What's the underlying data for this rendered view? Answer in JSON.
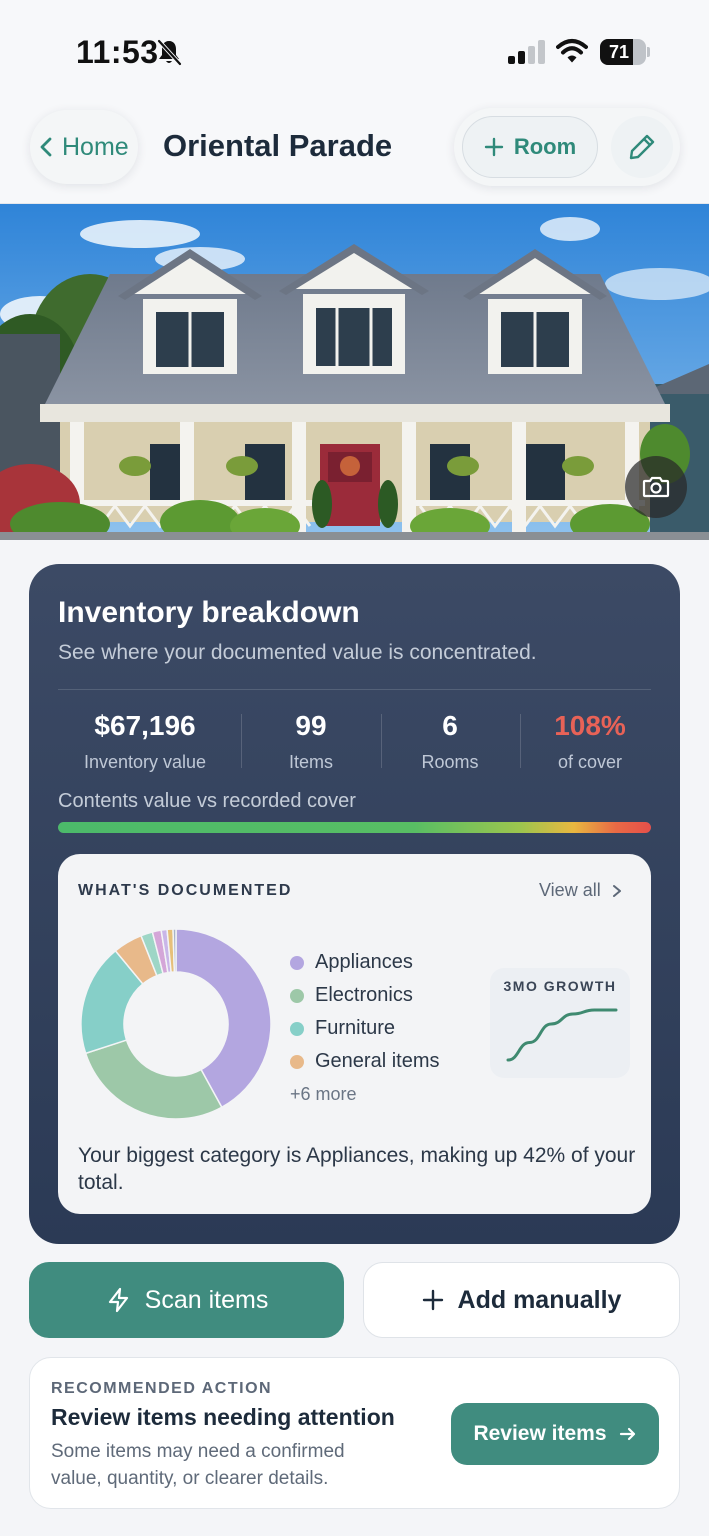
{
  "status_bar": {
    "time": "11:53",
    "battery_level": "71",
    "battery_fraction": 0.71,
    "icons": [
      "bell-slash-icon",
      "cellular-signal-icon",
      "wifi-icon",
      "battery-icon"
    ]
  },
  "header": {
    "back_label": "Home",
    "title": "Oriental Parade",
    "room_button_label": "Room",
    "icons": [
      "chevron-left-icon",
      "plus-icon",
      "pencil-icon"
    ]
  },
  "hero": {
    "icons": [
      "camera-icon"
    ]
  },
  "inventory": {
    "title": "Inventory breakdown",
    "subtitle": "See where your documented value is concentrated.",
    "stats": [
      {
        "value": "$67,196",
        "label": "Inventory value"
      },
      {
        "value": "99",
        "label": "Items"
      },
      {
        "value": "6",
        "label": "Rooms"
      },
      {
        "value": "108%",
        "label": "of cover"
      }
    ],
    "cover_label": "Contents value vs recorded cover",
    "cover_fraction": 1.0,
    "colors": {
      "warning": "#e86257",
      "card_bg": "#34425c"
    }
  },
  "documented": {
    "heading": "WHAT'S DOCUMENTED",
    "view_all_label": "View all",
    "legend": [
      {
        "label": "Appliances",
        "color": "#b3a6e0"
      },
      {
        "label": "Electronics",
        "color": "#9dc8a8"
      },
      {
        "label": "Furniture",
        "color": "#86cfc8"
      },
      {
        "label": "General items",
        "color": "#e8b98a"
      }
    ],
    "more_label": "+6 more",
    "growth_label": "3MO GROWTH",
    "summary": "Your biggest category is Appliances, making up 42% of your total.",
    "chart_data": {
      "type": "pie",
      "slices": [
        {
          "label": "Appliances",
          "value": 42,
          "color": "#b3a6e0"
        },
        {
          "label": "Electronics",
          "value": 28,
          "color": "#9dc8a8"
        },
        {
          "label": "Furniture",
          "value": 19,
          "color": "#86cfc8"
        },
        {
          "label": "General items",
          "value": 5,
          "color": "#e8b98a"
        },
        {
          "label": "",
          "value": 2,
          "color": "#9ed6c6"
        },
        {
          "label": "",
          "value": 1.5,
          "color": "#d4a6d8"
        },
        {
          "label": "",
          "value": 1,
          "color": "#c9b6e8"
        },
        {
          "label": "",
          "value": 1,
          "color": "#e6c07a"
        },
        {
          "label": "",
          "value": 0.5,
          "color": "#a7b4c8"
        }
      ],
      "growth": [
        0,
        0.35,
        0.72,
        0.92,
        1.0,
        1.0
      ]
    }
  },
  "actions": {
    "scan_label": "Scan items",
    "add_label": "Add manually",
    "icons": [
      "lightning-icon",
      "plus-icon"
    ]
  },
  "recommended": {
    "eyebrow": "RECOMMENDED ACTION",
    "title": "Review items needing attention",
    "description": "Some items may need a confirmed value, quantity, or clearer details.",
    "button_label": "Review items",
    "icons": [
      "arrow-right-icon"
    ]
  }
}
